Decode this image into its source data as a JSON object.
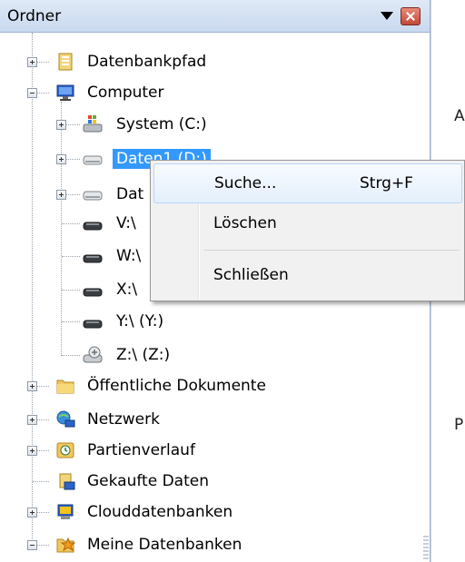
{
  "panel": {
    "title": "Ordner"
  },
  "tree": {
    "datenbankpfad": "Datenbankpfad",
    "computer": "Computer",
    "system_c": "System (C:)",
    "daten1": "Daten1 (D:)",
    "daten2_partial": "Dat",
    "v_drive": "V:\\",
    "w_drive": "W:\\",
    "x_drive": "X:\\",
    "y_drive": "Y:\\ (Y:)",
    "z_drive": "Z:\\ (Z:)",
    "oeffentliche": "Öffentliche Dokumente",
    "netzwerk": "Netzwerk",
    "partienverlauf": "Partienverlauf",
    "gekaufte": "Gekaufte Daten",
    "clouddatenbanken": "Clouddatenbanken",
    "meine": "Meine Datenbanken"
  },
  "context_menu": {
    "search": "Suche...",
    "search_shortcut": "Strg+F",
    "delete": "Löschen",
    "close": "Schließen"
  },
  "right_pane": {
    "fragment_a": "A",
    "fragment_p": "P"
  }
}
